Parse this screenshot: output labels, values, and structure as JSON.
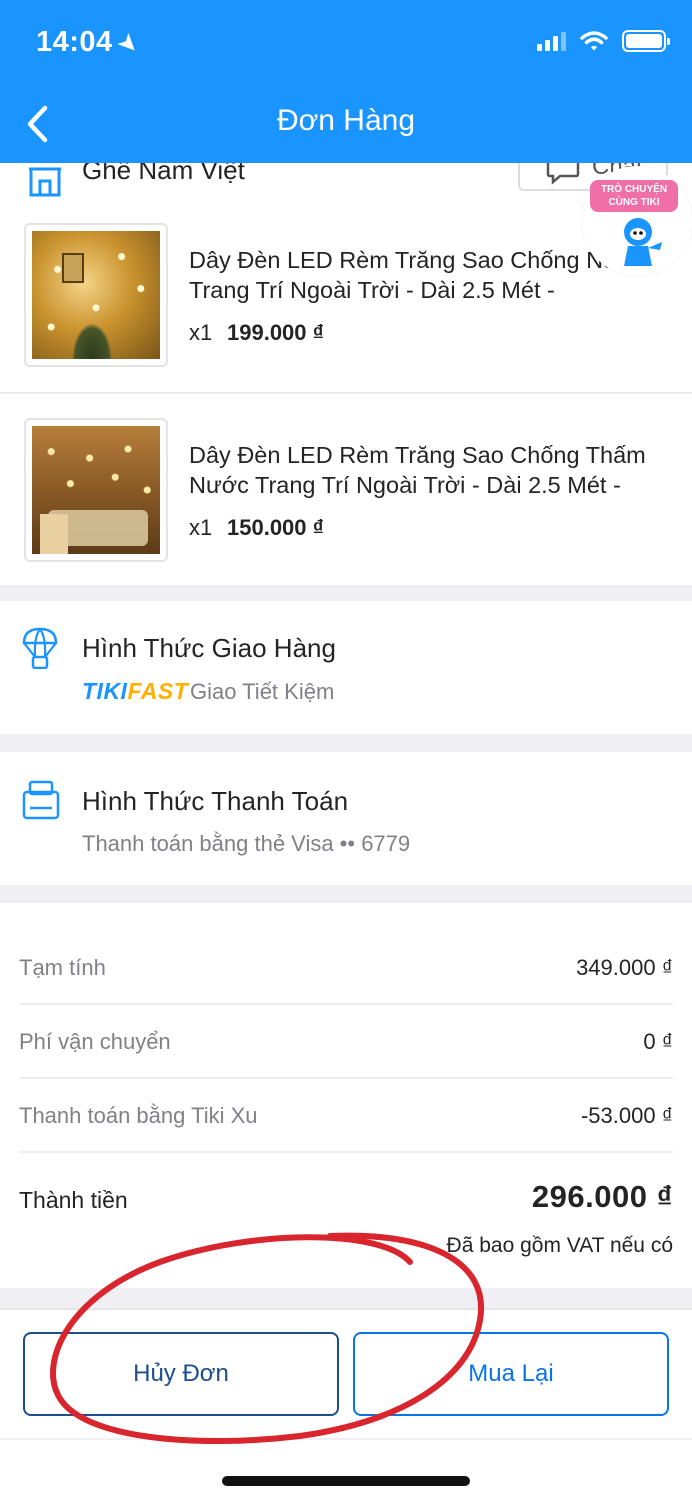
{
  "status_bar": {
    "time": "14:04"
  },
  "header": {
    "title": "Đơn Hàng"
  },
  "shop": {
    "name": "Ghế Nam Việt",
    "chat_label": "Chat"
  },
  "floater": {
    "label": "TRÒ CHUYỆN CÙNG TIKI"
  },
  "products": [
    {
      "name": "Dây Đèn LED Rèm Trăng Sao Chống Nước Trang Trí Ngoài Trời - Dài 2.5 Mét -",
      "qty": "x1",
      "price": "199.000 ₫"
    },
    {
      "name": "Dây Đèn LED Rèm Trăng Sao Chống Thấm Nước Trang Trí Ngoài Trời - Dài 2.5 Mét -",
      "qty": "x1",
      "price": "150.000 ₫"
    }
  ],
  "shipping": {
    "title": "Hình Thức Giao Hàng",
    "brand_part1": "TIKI",
    "brand_part2": "FAST",
    "method": "Giao Tiết Kiệm"
  },
  "payment": {
    "title": "Hình Thức Thanh Toán",
    "method": "Thanh toán bằng thẻ Visa •• 6779"
  },
  "summary": {
    "rows": [
      {
        "label": "Tạm tính",
        "value": "349.000 ₫"
      },
      {
        "label": "Phí vận chuyển",
        "value": "0 ₫"
      },
      {
        "label": "Thanh toán bằng Tiki Xu",
        "value": "-53.000 ₫"
      }
    ],
    "total_label": "Thành tiền",
    "total_value": "296.000 ₫",
    "vat_note": "Đã bao gồm VAT nếu có"
  },
  "actions": {
    "cancel_label": "Hủy Đơn",
    "reorder_label": "Mua Lại"
  },
  "colors": {
    "header": "#1a94ff",
    "accent": "#0b74e5",
    "annotation": "#d9252d"
  }
}
